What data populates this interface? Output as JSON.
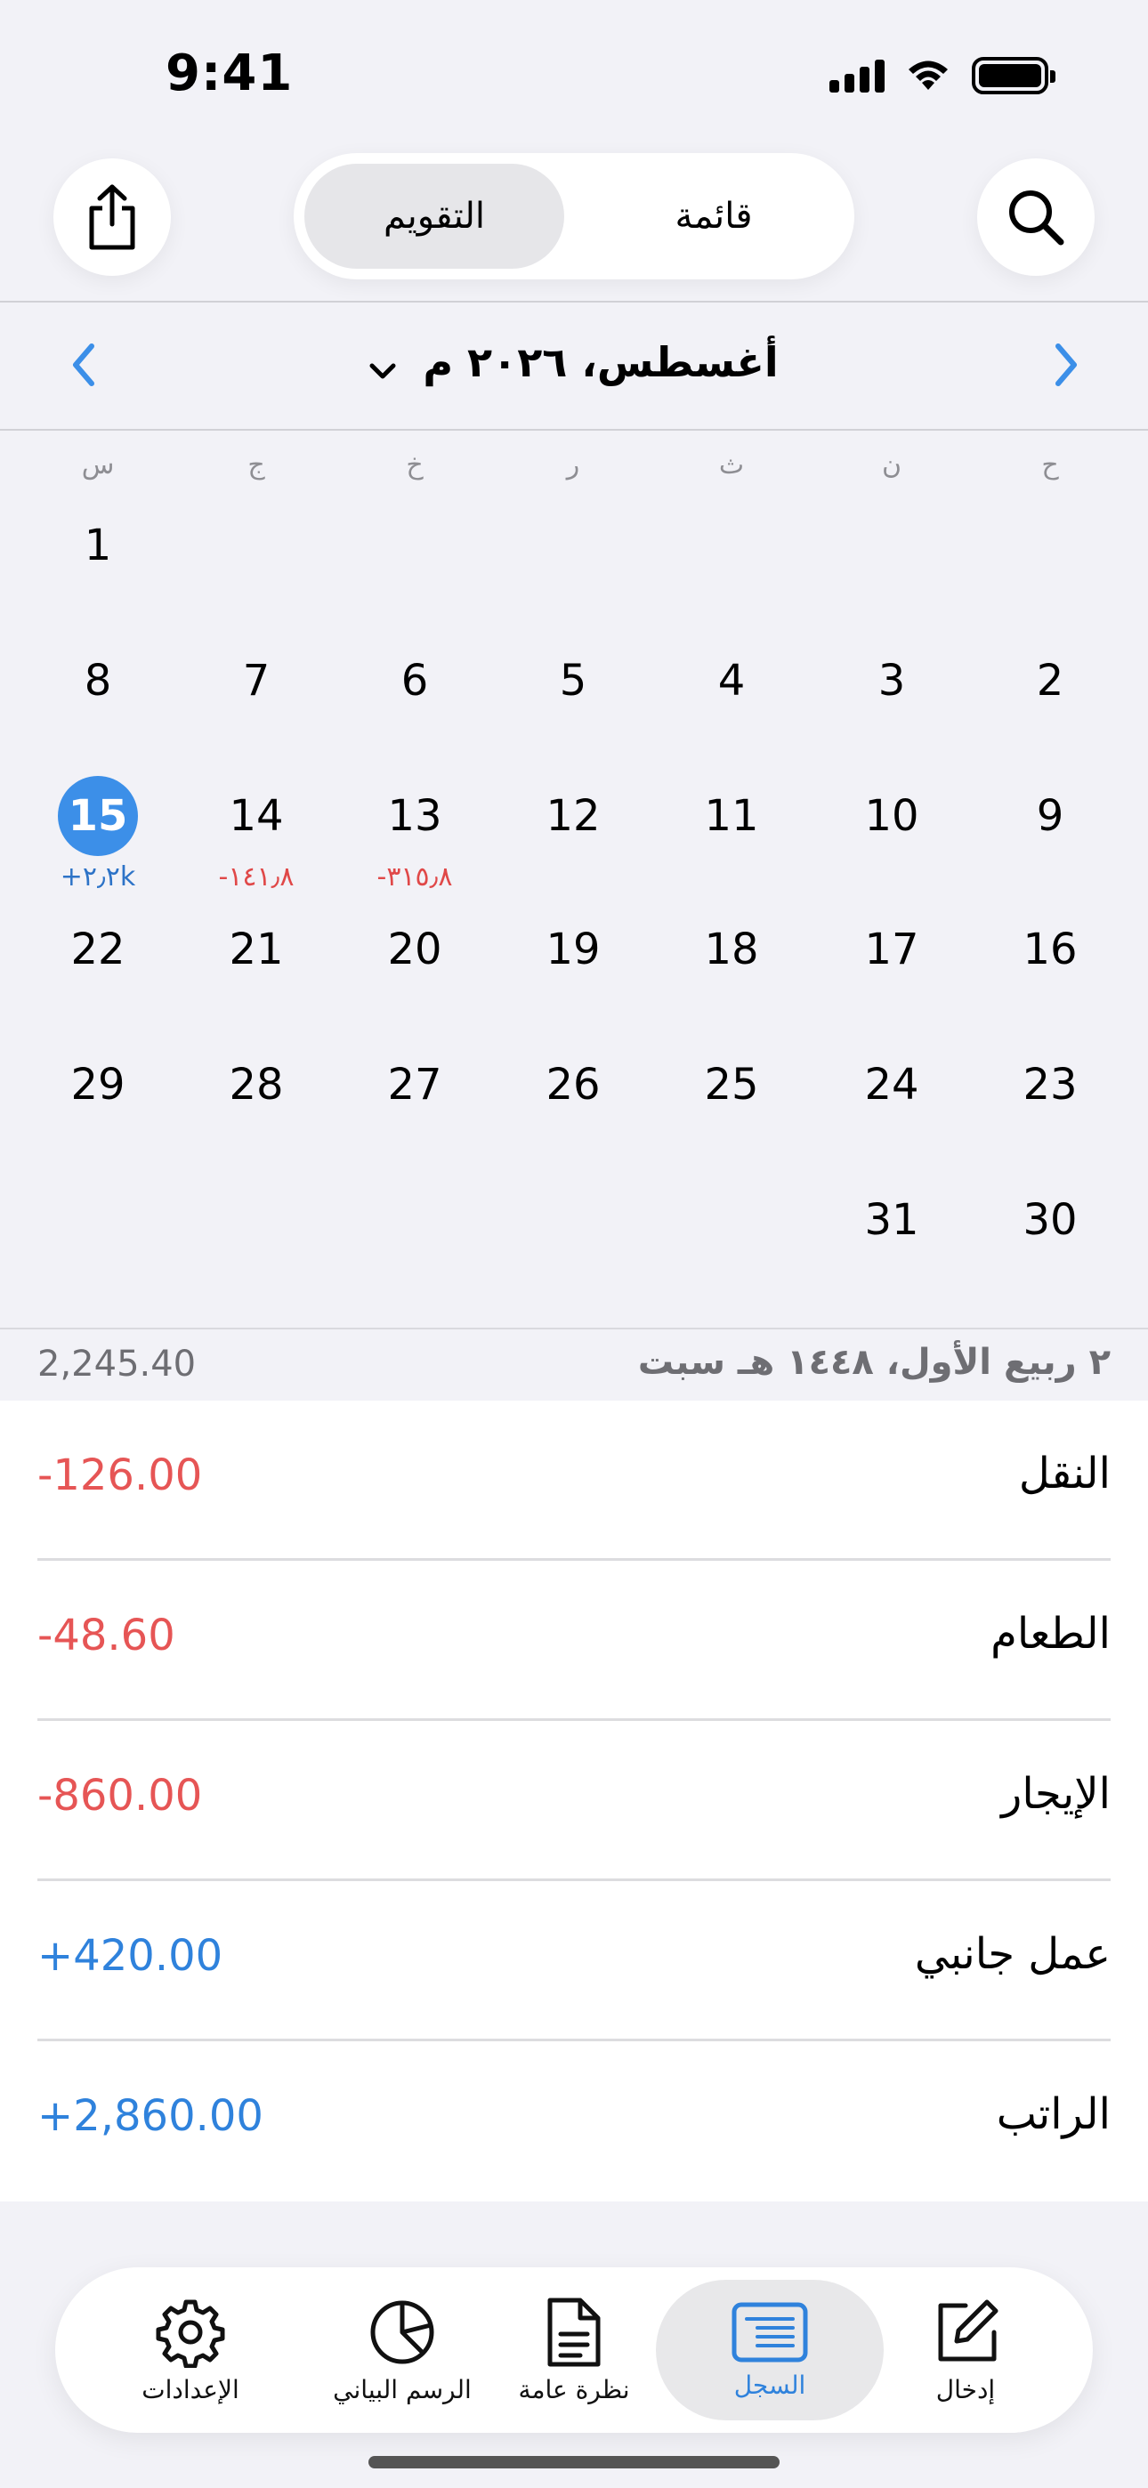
{
  "status": {
    "time": "9:41"
  },
  "header": {
    "segments": [
      {
        "label": "التقويم",
        "active": true
      },
      {
        "label": "قائمة",
        "active": false
      }
    ],
    "icons": {
      "left": "share-icon",
      "right": "search-icon"
    }
  },
  "calendar": {
    "month_label": "أغسطس، ٢٠٢٦ م",
    "weekdays": [
      "ح",
      "ن",
      "ث",
      "ر",
      "خ",
      "ج",
      "س"
    ],
    "weeks": [
      [
        {
          "d": ""
        },
        {
          "d": ""
        },
        {
          "d": ""
        },
        {
          "d": ""
        },
        {
          "d": ""
        },
        {
          "d": ""
        },
        {
          "d": "1"
        }
      ],
      [
        {
          "d": "2"
        },
        {
          "d": "3"
        },
        {
          "d": "4"
        },
        {
          "d": "5"
        },
        {
          "d": "6"
        },
        {
          "d": "7"
        },
        {
          "d": "8"
        }
      ],
      [
        {
          "d": "9"
        },
        {
          "d": "10"
        },
        {
          "d": "11"
        },
        {
          "d": "12"
        },
        {
          "d": "13",
          "amt": "-٣١٥٫٨",
          "type": "neg"
        },
        {
          "d": "14",
          "amt": "-١٤١٫٨",
          "type": "neg"
        },
        {
          "d": "15",
          "amt": "+٢٫٢k",
          "type": "pos",
          "selected": true
        }
      ],
      [
        {
          "d": "16"
        },
        {
          "d": "17"
        },
        {
          "d": "18"
        },
        {
          "d": "19"
        },
        {
          "d": "20"
        },
        {
          "d": "21"
        },
        {
          "d": "22"
        }
      ],
      [
        {
          "d": "23"
        },
        {
          "d": "24"
        },
        {
          "d": "25"
        },
        {
          "d": "26"
        },
        {
          "d": "27"
        },
        {
          "d": "28"
        },
        {
          "d": "29"
        }
      ],
      [
        {
          "d": "30"
        },
        {
          "d": "31"
        },
        {
          "d": ""
        },
        {
          "d": ""
        },
        {
          "d": ""
        },
        {
          "d": ""
        },
        {
          "d": ""
        }
      ]
    ]
  },
  "summary": {
    "date": "٢ ربيع الأول، ١٤٤٨ هـ سبت",
    "total": "2,245.40"
  },
  "transactions": [
    {
      "category": "النقل",
      "amount": "-126.00",
      "type": "neg"
    },
    {
      "category": "الطعام",
      "amount": "-48.60",
      "type": "neg"
    },
    {
      "category": "الإيجار",
      "amount": "-860.00",
      "type": "neg"
    },
    {
      "category": "عمل جانبي",
      "amount": "+420.00",
      "type": "pos"
    },
    {
      "category": "الراتب",
      "amount": "+2,860.00",
      "type": "pos"
    }
  ],
  "tabbar": [
    {
      "label": "الإعدادات",
      "icon": "gear-icon",
      "active": false
    },
    {
      "label": "الرسم البياني",
      "icon": "pie-chart-icon",
      "active": false
    },
    {
      "label": "نظرة عامة",
      "icon": "document-icon",
      "active": false
    },
    {
      "label": "السجل",
      "icon": "list-icon",
      "active": true
    },
    {
      "label": "إدخال",
      "icon": "compose-icon",
      "active": false
    }
  ],
  "colors": {
    "accent": "#3c8fe8",
    "negative": "#e65555",
    "positive": "#2f82dc"
  }
}
